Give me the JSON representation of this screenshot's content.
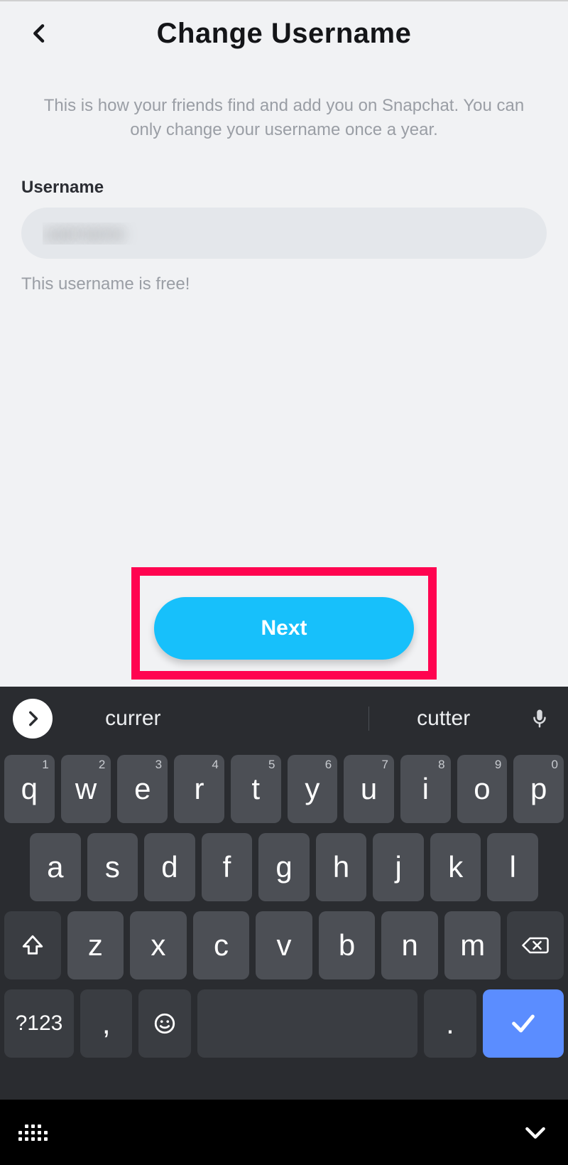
{
  "header": {
    "title": "Change Username"
  },
  "subtitle": "This is how your friends find and add you on Snapchat. You can only change your username once a year.",
  "field": {
    "label": "Username",
    "value": "username",
    "status": "This username is free!"
  },
  "actions": {
    "next_label": "Next"
  },
  "keyboard": {
    "suggestions": [
      "currer",
      "",
      "cutter"
    ],
    "row1": [
      {
        "l": "q",
        "n": "1"
      },
      {
        "l": "w",
        "n": "2"
      },
      {
        "l": "e",
        "n": "3"
      },
      {
        "l": "r",
        "n": "4"
      },
      {
        "l": "t",
        "n": "5"
      },
      {
        "l": "y",
        "n": "6"
      },
      {
        "l": "u",
        "n": "7"
      },
      {
        "l": "i",
        "n": "8"
      },
      {
        "l": "o",
        "n": "9"
      },
      {
        "l": "p",
        "n": "0"
      }
    ],
    "row2": [
      "a",
      "s",
      "d",
      "f",
      "g",
      "h",
      "j",
      "k",
      "l"
    ],
    "row3": [
      "z",
      "x",
      "c",
      "v",
      "b",
      "n",
      "m"
    ],
    "row4": {
      "symbols": "?123",
      "comma": ",",
      "dot": "."
    }
  }
}
